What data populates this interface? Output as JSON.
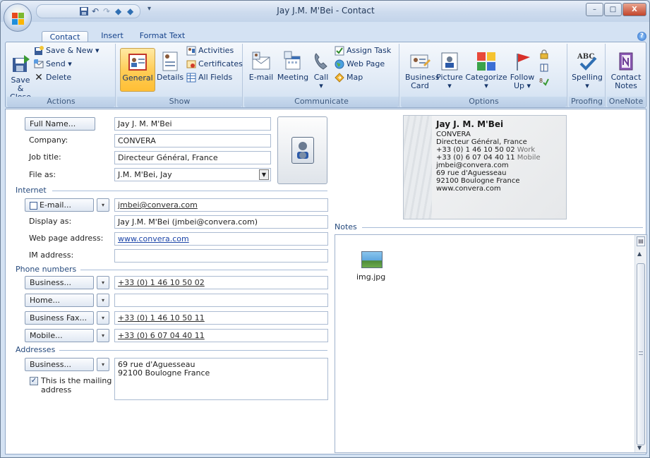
{
  "window": {
    "title": "Jay J.M. M'Bei - Contact",
    "controls": {
      "minimize": "–",
      "maximize": "□",
      "close": "X"
    }
  },
  "qat": {
    "icons": [
      "save-icon",
      "undo-icon",
      "redo-icon",
      "up-arrow-icon",
      "down-arrow-icon"
    ],
    "more": "▾"
  },
  "tabs": [
    {
      "label": "Contact",
      "active": true
    },
    {
      "label": "Insert"
    },
    {
      "label": "Format Text"
    }
  ],
  "ribbon": {
    "actions": {
      "label": "Actions",
      "save_close": "Save &",
      "save_close2": "Close",
      "save_new": "Save & New ▾",
      "send": "Send ▾",
      "delete": "Delete"
    },
    "show": {
      "label": "Show",
      "general": "General",
      "details": "Details",
      "activities": "Activities",
      "certificates": "Certificates",
      "all_fields": "All Fields"
    },
    "communicate": {
      "label": "Communicate",
      "email": "E-mail",
      "meeting": "Meeting",
      "call": "Call",
      "call_arrow": "▾",
      "assign_task": "Assign Task",
      "web_page": "Web Page",
      "map": "Map"
    },
    "options": {
      "label": "Options",
      "business_card": "Business",
      "business_card2": "Card",
      "picture": "Picture",
      "picture_arrow": "▾",
      "categorize": "Categorize",
      "categorize_arrow": "▾",
      "follow_up": "Follow",
      "follow_up2": "Up ▾"
    },
    "proofing": {
      "label": "Proofing",
      "spelling": "Spelling",
      "spelling_arrow": "▾"
    },
    "onenote": {
      "label": "OneNote",
      "contact_notes": "Contact",
      "contact_notes2": "Notes"
    }
  },
  "form": {
    "full_name_btn": "Full Name...",
    "full_name": "Jay J. M. M'Bei",
    "company_label": "Company:",
    "company": "CONVERA",
    "job_title_label": "Job title:",
    "job_title": "Directeur Général, France",
    "file_as_label": "File as:",
    "file_as": "J.M. M'Bei, Jay",
    "internet_header": "Internet",
    "email_btn": "E-mail...",
    "email": "jmbei@convera.com",
    "display_as_label": "Display as:",
    "display_as": "Jay J.M. M'Bei (jmbei@convera.com)",
    "web_label": "Web page address:",
    "web": "www.convera.com",
    "im_label": "IM address:",
    "im": "",
    "phone_header": "Phone numbers",
    "phones": [
      {
        "type": "Business...",
        "value": "+33 (0) 1 46 10 50 02"
      },
      {
        "type": "Home...",
        "value": ""
      },
      {
        "type": "Business Fax...",
        "value": "+33 (0) 1 46 10 50 11"
      },
      {
        "type": "Mobile...",
        "value": "+33 (0) 6 07 04 40 11"
      }
    ],
    "addresses_header": "Addresses",
    "address_btn": "Business...",
    "address_line1": "69 rue d'Aguesseau",
    "address_line2": "92100  Boulogne France",
    "mailing_checkbox": "This is the mailing",
    "mailing_checkbox2": "address",
    "mailing_checked": true
  },
  "business_card": {
    "name": "Jay J. M. M'Bei",
    "company": "CONVERA",
    "title": "Directeur Général, France",
    "phone_work": "+33 (0) 1 46 10 50 02",
    "phone_work_tag": "Work",
    "phone_mobile": "+33 (0) 6 07 04 40 11",
    "phone_mobile_tag": "Mobile",
    "email": "jmbei@convera.com",
    "street": "69 rue d'Aguesseau",
    "city": "92100  Boulogne France",
    "web": "www.convera.com"
  },
  "notes": {
    "header": "Notes",
    "attachment_name": "img.jpg"
  },
  "colors": {
    "accent": "#15428b",
    "frame": "#c9d9ec",
    "active_button": "#ffcd58"
  }
}
